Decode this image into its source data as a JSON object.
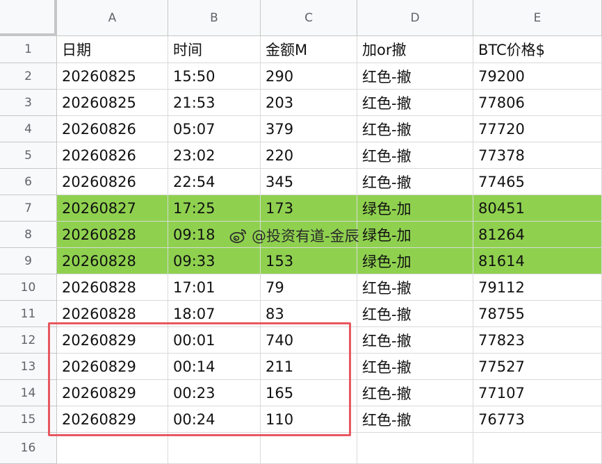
{
  "columns": [
    "A",
    "B",
    "C",
    "D",
    "E"
  ],
  "row_numbers": [
    "1",
    "2",
    "3",
    "4",
    "5",
    "6",
    "7",
    "8",
    "9",
    "10",
    "11",
    "12",
    "13",
    "14",
    "15",
    "16"
  ],
  "rows": [
    {
      "cells": [
        "日期",
        "时间",
        "金额M",
        "加or撤",
        "BTC价格$"
      ],
      "highlight": false
    },
    {
      "cells": [
        "20260825",
        "15:50",
        "290",
        "红色-撤",
        "79200"
      ],
      "highlight": false
    },
    {
      "cells": [
        "20260825",
        "21:53",
        "203",
        "红色-撤",
        "77806"
      ],
      "highlight": false
    },
    {
      "cells": [
        "20260826",
        "05:07",
        "379",
        "红色-撤",
        "77720"
      ],
      "highlight": false
    },
    {
      "cells": [
        "20260826",
        "23:02",
        "220",
        "红色-撤",
        "77378"
      ],
      "highlight": false
    },
    {
      "cells": [
        "20260826",
        "22:54",
        "345",
        "红色-撤",
        "77465"
      ],
      "highlight": false
    },
    {
      "cells": [
        "20260827",
        "17:25",
        "173",
        "绿色-加",
        "80451"
      ],
      "highlight": true
    },
    {
      "cells": [
        "20260828",
        "09:18",
        "",
        "绿色-加",
        "81264"
      ],
      "highlight": true
    },
    {
      "cells": [
        "20260828",
        "09:33",
        "153",
        "绿色-加",
        "81614"
      ],
      "highlight": true
    },
    {
      "cells": [
        "20260828",
        "17:01",
        "79",
        "红色-撤",
        "79112"
      ],
      "highlight": false
    },
    {
      "cells": [
        "20260828",
        "18:07",
        "83",
        "红色-撤",
        "78755"
      ],
      "highlight": false
    },
    {
      "cells": [
        "20260829",
        "00:01",
        "740",
        "红色-撤",
        "77823"
      ],
      "highlight": false
    },
    {
      "cells": [
        "20260829",
        "00:14",
        "211",
        "红色-撤",
        "77527"
      ],
      "highlight": false
    },
    {
      "cells": [
        "20260829",
        "00:23",
        "165",
        "红色-撤",
        "77107"
      ],
      "highlight": false
    },
    {
      "cells": [
        "20260829",
        "00:24",
        "110",
        "红色-撤",
        "76773"
      ],
      "highlight": false
    },
    {
      "cells": [
        "",
        "",
        "",
        "",
        ""
      ],
      "highlight": false
    }
  ],
  "watermark": {
    "text": "@投资有道-金辰",
    "icon": "weibo-icon"
  },
  "colors": {
    "highlight": "#8fd14f",
    "selection_border": "#e8575e",
    "header_bg": "#f8f9fa"
  }
}
